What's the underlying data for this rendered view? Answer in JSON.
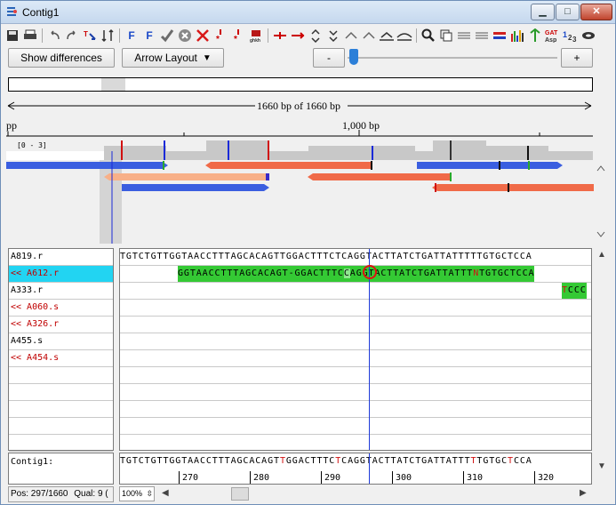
{
  "window": {
    "title": "Contig1",
    "min_glyph": "▁",
    "max_glyph": "□",
    "close_glyph": "✕"
  },
  "toolbar": {
    "icons": [
      "save-icon",
      "print-icon",
      "undo-icon",
      "redo-icon",
      "sort-icon",
      "sort-order-icon",
      "find-forward-icon",
      "find-reverse-icon",
      "accept-icon",
      "reject-icon",
      "reject-x-icon",
      "mark-icon",
      "mark2-icon",
      "flag-icon",
      "prev-conflict-icon",
      "next-conflict-icon",
      "up-icon",
      "down-icon",
      "shift-left-icon",
      "shift-right-icon",
      "collapse-icon",
      "expand-icon",
      "search-icon",
      "copy-icon",
      "align-icon",
      "align2-icon",
      "color-icon",
      "quality-icon",
      "translate-icon",
      "aa-icon",
      "number-icon",
      "link-icon"
    ]
  },
  "controls": {
    "show_differences": "Show differences",
    "arrow_layout": "Arrow Layout",
    "arrow_layout_caret": "▼",
    "zoom_minus": "-",
    "zoom_plus": "+",
    "zoom_level": 0.04
  },
  "assembly": {
    "length_label": "1660 bp of 1660 bp",
    "ruler_left": "pp",
    "ruler_mark": "1,000 bp",
    "coverage_label": "[0 - 3]"
  },
  "reads": [
    {
      "name": "A819.r",
      "reverse": false,
      "selected": false
    },
    {
      "name": "<< A612.r",
      "reverse": true,
      "selected": true
    },
    {
      "name": "A333.r",
      "reverse": false,
      "selected": false
    },
    {
      "name": "<< A060.s",
      "reverse": true,
      "selected": false
    },
    {
      "name": "<< A326.r",
      "reverse": true,
      "selected": false
    },
    {
      "name": "A455.s",
      "reverse": false,
      "selected": false
    },
    {
      "name": "<< A454.s",
      "reverse": true,
      "selected": false
    }
  ],
  "sequences": {
    "a819": "TGTCTGTTGGTAACCTTTAGCACAGTTGGACTTTCTCAGGTACTTATCTGATTATTTTTGTGCTCCA",
    "a612_prefix": "GGTAACCTTTAGCACAGT-GGACTTTC",
    "a612_mid": "C",
    "a612_suffix": "AGGTACTTATCTGATTATTT",
    "a612_n": "N",
    "a612_tail": "TGTGCTCCA",
    "a333_red": "T",
    "a333": "CCC"
  },
  "contig": {
    "label": "Contig1:",
    "seq_a": "TGTCTGTTGGTAACCTTTAGCACAGT",
    "seq_t1": "T",
    "seq_b": "GGACTTTC",
    "seq_t2": "T",
    "seq_c": "CAGGTACTTATCTGATTATTT",
    "seq_t3": "T",
    "seq_d": "TGTGC",
    "seq_t4": "T",
    "seq_e": "CCA",
    "ruler": [
      "270",
      "280",
      "290",
      "300",
      "310",
      "320"
    ]
  },
  "status": {
    "position": "Pos: 297/1660",
    "quality": "Qual: 9 (",
    "zoom": "100%"
  }
}
